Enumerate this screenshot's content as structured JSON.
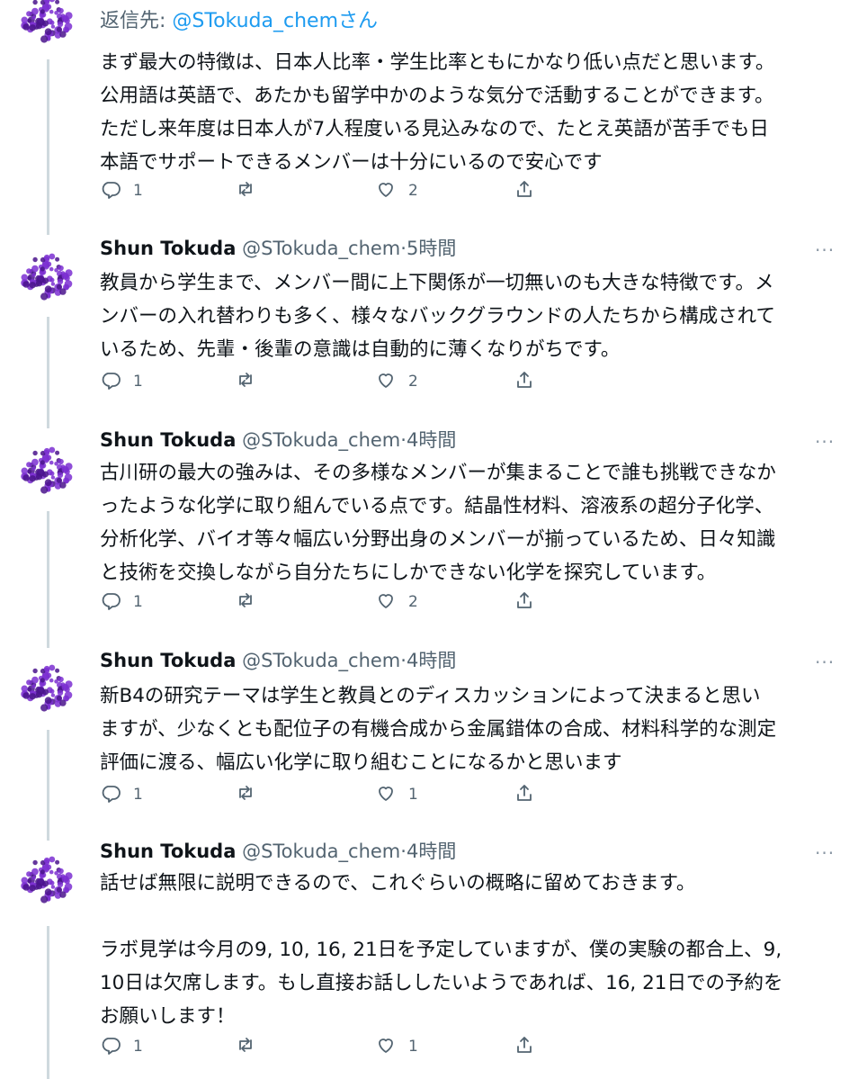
{
  "reply_to": {
    "label": "返信先:",
    "handle": "@STokuda_chemさん"
  },
  "tweets": [
    {
      "text": "まず最大の特徴は、日本人比率・学生比率ともにかなり低い点だと思います。\n公用語は英語で、あたかも留学中かのような気分で活動することができます。\nただし来年度は日本人が7人程度いる見込みなので、たとえ英語が苦手でも日\n本語でサポートできるメンバーは十分にいるので安心です",
      "replies": "1",
      "retweets": "",
      "likes": "2"
    },
    {
      "name": "Shun Tokuda",
      "handle": "@STokuda_chem",
      "time": "5時間",
      "text": "教員から学生まで、メンバー間に上下関係が一切無いのも大きな特徴です。メ\nンバーの入れ替わりも多く、様々なバックグラウンドの人たちから構成されて\nいるため、先輩・後輩の意識は自動的に薄くなりがちです。",
      "replies": "1",
      "retweets": "",
      "likes": "2"
    },
    {
      "name": "Shun Tokuda",
      "handle": "@STokuda_chem",
      "time": "4時間",
      "text": "古川研の最大の強みは、その多様なメンバーが集まることで誰も挑戦できなか\nったような化学に取り組んでいる点です。結晶性材料、溶液系の超分子化学、\n分析化学、バイオ等々幅広い分野出身のメンバーが揃っているため、日々知識\nと技術を交換しながら自分たちにしかできない化学を探究しています。",
      "replies": "1",
      "retweets": "",
      "likes": "2"
    },
    {
      "name": "Shun Tokuda",
      "handle": "@STokuda_chem",
      "time": "4時間",
      "text": "新B4の研究テーマは学生と教員とのディスカッションによって決まると思い\nますが、少なくとも配位子の有機合成から金属錯体の合成、材料科学的な測定\n評価に渡る、幅広い化学に取り組むことになるかと思います",
      "replies": "1",
      "retweets": "",
      "likes": "1"
    },
    {
      "name": "Shun Tokuda",
      "handle": "@STokuda_chem",
      "time": "4時間",
      "text": "話せば無限に説明できるので、これぐらいの概略に留めておきます。\n\nラボ見学は今月の9, 10, 16, 21日を予定していますが、僕の実験の都合上、9,\n10日は欠席します。もし直接お話ししたいようであれば、16, 21日での予約を\nお願いします！",
      "replies": "1",
      "retweets": "",
      "likes": "1"
    }
  ],
  "separator": "·",
  "more_glyph": "···",
  "colors": {
    "link": "#1d9bf0",
    "secondary": "#536471",
    "avatar": "#7b2fd1"
  },
  "icons": [
    "reply-icon",
    "retweet-icon",
    "like-icon",
    "share-icon",
    "more-icon"
  ]
}
